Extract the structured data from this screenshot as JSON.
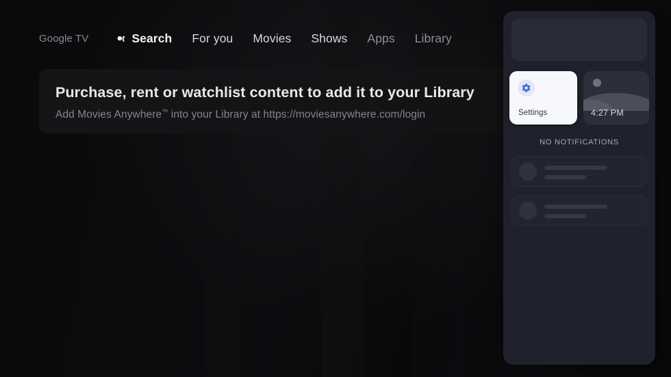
{
  "nav": {
    "logo": "Google TV",
    "items": [
      {
        "label": "Search",
        "icon": "search-icon",
        "state": "focused"
      },
      {
        "label": "For you",
        "state": "normal"
      },
      {
        "label": "Movies",
        "state": "normal"
      },
      {
        "label": "Shows",
        "state": "normal"
      },
      {
        "label": "Apps",
        "state": "dim"
      },
      {
        "label": "Library",
        "state": "dim"
      }
    ]
  },
  "banner": {
    "title": "Purchase, rent or watchlist content to add it to your Library",
    "subtitle_before": "Add Movies Anywhere",
    "subtitle_tm": "™",
    "subtitle_after": " into your Library at https://moviesanywhere.com/login"
  },
  "panel": {
    "tiles": {
      "settings": {
        "label": "Settings",
        "icon": "gear-icon"
      },
      "clock": {
        "label": "4:27 PM",
        "icon": "night-scene-icon"
      }
    },
    "notifications": {
      "empty_label": "NO NOTIFICATIONS",
      "placeholders": [
        {
          "id": "placeholder-1"
        },
        {
          "id": "placeholder-2"
        }
      ]
    }
  },
  "colors": {
    "background": "#0a0a0c",
    "panel": "#1f222c",
    "banner": "#151517",
    "tile_settings_bg": "#f7f8fb",
    "tile_clock_bg": "#2b2f3a",
    "accent_gear": "#3f68d4",
    "text_primary": "#e9e9ec",
    "text_secondary": "#85858a"
  }
}
